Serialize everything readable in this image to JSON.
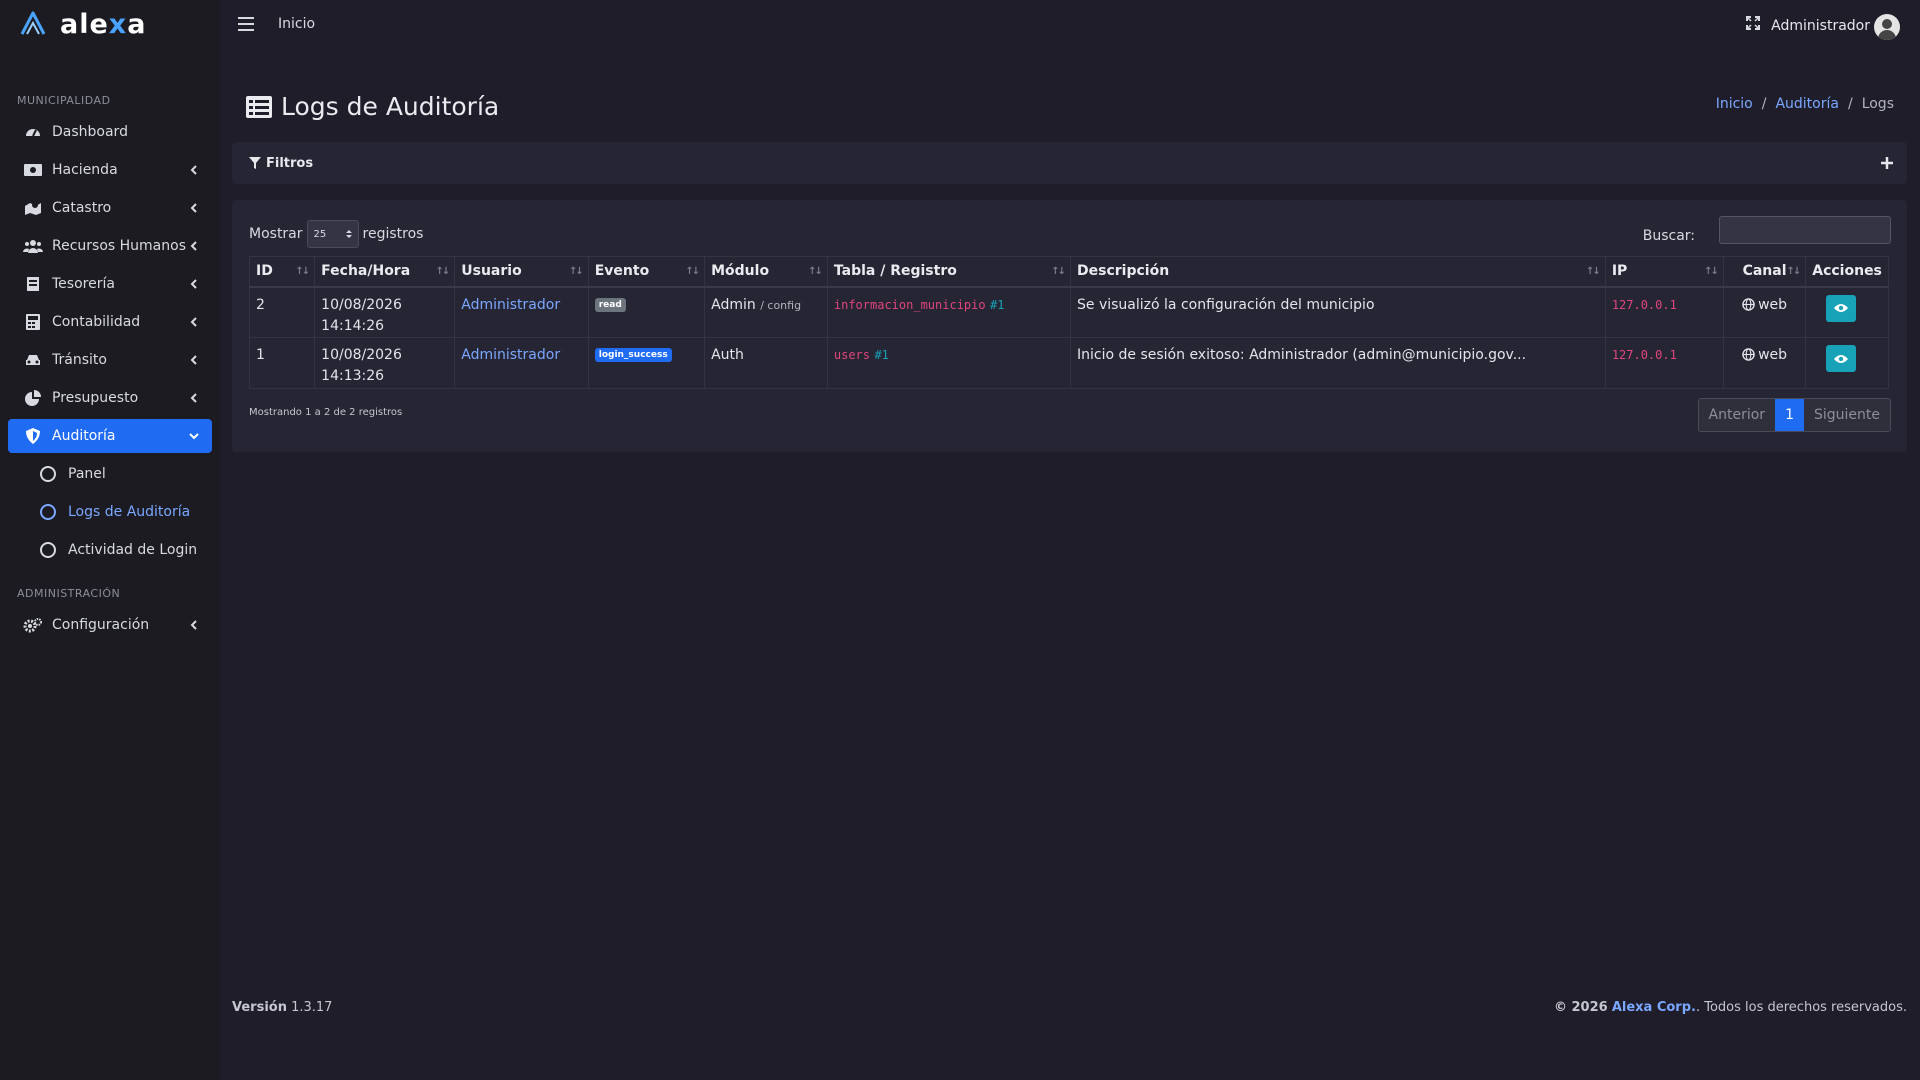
{
  "brand": {
    "name_part1": "ale",
    "name_x": "x",
    "name_part2": "a"
  },
  "topbar": {
    "home_label": "Inicio",
    "user_name": "Administrador"
  },
  "sidebar": {
    "section_municipal": "MUNICIPALIDAD",
    "section_admin": "ADMINISTRACIÓN",
    "items": [
      {
        "label": "Dashboard",
        "icon": "dashboard-icon"
      },
      {
        "label": "Hacienda",
        "icon": "money-icon"
      },
      {
        "label": "Catastro",
        "icon": "cadastre-icon"
      },
      {
        "label": "Recursos Humanos",
        "icon": "users-icon"
      },
      {
        "label": "Tesorería",
        "icon": "treasury-icon"
      },
      {
        "label": "Contabilidad",
        "icon": "calculator-icon"
      },
      {
        "label": "Tránsito",
        "icon": "car-icon"
      },
      {
        "label": "Presupuesto",
        "icon": "pie-chart-icon"
      },
      {
        "label": "Auditoría",
        "icon": "shield-icon"
      }
    ],
    "sub_items": [
      {
        "label": "Panel"
      },
      {
        "label": "Logs de Auditoría"
      },
      {
        "label": "Actividad de Login"
      }
    ],
    "config_label": "Configuración"
  },
  "page": {
    "title": "Logs de Auditoría",
    "breadcrumb": [
      "Inicio",
      "Auditoría",
      "Logs"
    ]
  },
  "filters": {
    "title": "Filtros"
  },
  "table_controls": {
    "show_label": "Mostrar",
    "page_size": "25",
    "records_label": "registros",
    "search_label": "Buscar:",
    "search_value": ""
  },
  "table": {
    "columns": [
      "ID",
      "Fecha/Hora",
      "Usuario",
      "Evento",
      "Módulo",
      "Tabla / Registro",
      "Descripción",
      "IP",
      "Canal",
      "Acciones"
    ],
    "rows": [
      {
        "id": "2",
        "date": "10/08/2026",
        "time": "14:14:26",
        "user": "Administrador",
        "event": "read",
        "module": "Admin",
        "module_sub": "/ config",
        "table_name": "informacion_municipio",
        "record_id": "#1",
        "description": "Se visualizó la configuración del municipio",
        "ip": "127.0.0.1",
        "channel": "web"
      },
      {
        "id": "1",
        "date": "10/08/2026",
        "time": "14:13:26",
        "user": "Administrador",
        "event": "login_success",
        "module": "Auth",
        "module_sub": "",
        "table_name": "users",
        "record_id": "#1",
        "description": "Inicio de sesión exitoso: Administrador (admin@municipio.gov...",
        "ip": "127.0.0.1",
        "channel": "web"
      }
    ]
  },
  "table_info": "Mostrando 1 a 2 de 2 registros",
  "pagination": {
    "prev": "Anterior",
    "current": "1",
    "next": "Siguiente"
  },
  "footer": {
    "version_label": "Versión",
    "version": "1.3.17",
    "copyright": "© 2026",
    "company": "Alexa Corp.",
    "rights": ". Todos los derechos reservados."
  },
  "colors": {
    "accent": "#1f6bf2",
    "link": "#7aa7ff",
    "info": "#17a2b8",
    "code": "#e0457b",
    "background": "#1f1d29"
  }
}
